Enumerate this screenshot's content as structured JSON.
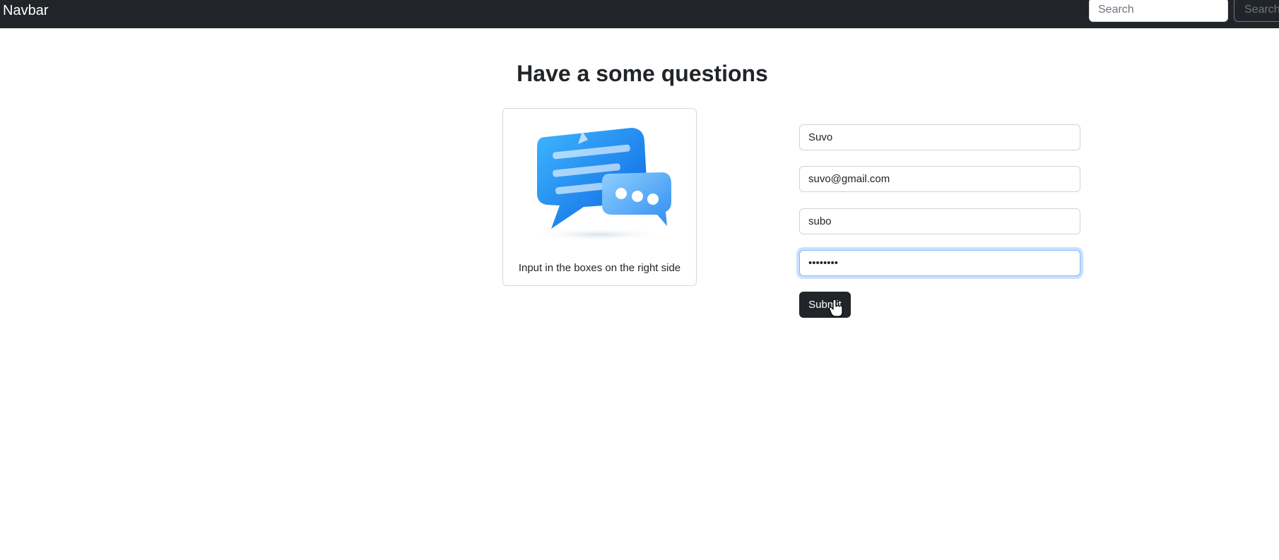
{
  "navbar": {
    "brand": "Navbar",
    "search_placeholder": "Search",
    "search_button": "Search"
  },
  "page": {
    "title": "Have a some questions"
  },
  "card": {
    "image_icon": "chat-bubbles-icon",
    "text": "Input in the boxes on the right side"
  },
  "form": {
    "name_value": "Suvo",
    "email_value": "suvo@gmail.com",
    "username_value": "subo",
    "password_value": "password",
    "submit_label": "Submit"
  },
  "colors": {
    "navbar_bg": "#212529",
    "accent_focus": "#86b7fe",
    "bubble_blue": "#1e88f5",
    "button_bg": "#212529"
  }
}
